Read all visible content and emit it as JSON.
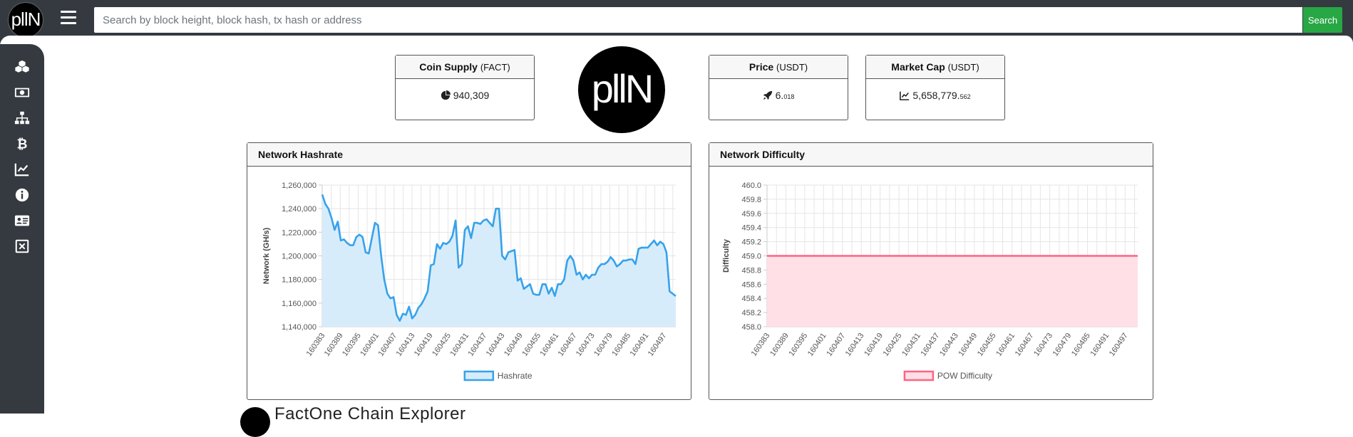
{
  "header": {
    "logo_text": "pllN",
    "search_placeholder": "Search by block height, block hash, tx hash or address",
    "search_button": "Search"
  },
  "sidebar": {
    "items": [
      {
        "icon": "cubes-icon"
      },
      {
        "icon": "money-bill-icon"
      },
      {
        "icon": "network-icon"
      },
      {
        "icon": "bitcoin-icon"
      },
      {
        "icon": "chart-line-icon"
      },
      {
        "icon": "info-circle-icon"
      },
      {
        "icon": "id-card-icon"
      },
      {
        "icon": "close-box-icon"
      }
    ]
  },
  "stats": {
    "coin_supply": {
      "label": "Coin Supply",
      "unit": "(FACT)",
      "value": "940,309"
    },
    "price": {
      "label": "Price",
      "unit": "(USDT)",
      "value_main": "6.",
      "value_small": "018"
    },
    "market_cap": {
      "label": "Market Cap",
      "unit": "(USDT)",
      "value_main": "5,658,779.",
      "value_small": "562"
    }
  },
  "center_logo_text": "pllN",
  "footer_text": "FactOne Chain Explorer",
  "colors": {
    "topbar": "#343a40",
    "search_button": "#28a745",
    "hashrate_line": "#36a2eb",
    "hashrate_fill": "#d7ecfb",
    "difficulty_line": "#ff6384",
    "difficulty_fill": "#ffe0e6"
  },
  "chart_data": [
    {
      "type": "area",
      "title": "Network Hashrate",
      "xlabel": "",
      "ylabel": "Network (GH/s)",
      "x_tick_labels": [
        "160383",
        "160389",
        "160395",
        "160401",
        "160407",
        "160413",
        "160419",
        "160425",
        "160431",
        "160437",
        "160443",
        "160449",
        "160455",
        "160461",
        "160467",
        "160473",
        "160479",
        "160485",
        "160491",
        "160497"
      ],
      "x_start": 160383,
      "x_end": 160501,
      "ylim": [
        1140000,
        1260000
      ],
      "y_tick_labels": [
        "1,260,000",
        "1,240,000",
        "1,220,000",
        "1,200,000",
        "1,180,000",
        "1,160,000",
        "1,140,000"
      ],
      "legend_position": "bottom",
      "series": [
        {
          "name": "Hashrate",
          "values": [
            1252000,
            1244000,
            1240000,
            1232000,
            1222000,
            1229000,
            1213000,
            1214000,
            1211000,
            1209000,
            1209000,
            1216000,
            1218000,
            1216000,
            1203000,
            1202000,
            1215000,
            1228000,
            1226000,
            1200000,
            1180000,
            1168000,
            1164000,
            1165000,
            1150000,
            1145000,
            1151000,
            1150000,
            1157000,
            1147000,
            1150000,
            1156000,
            1159000,
            1164000,
            1170000,
            1192000,
            1193000,
            1210000,
            1206000,
            1211000,
            1210000,
            1212000,
            1217000,
            1230000,
            1190000,
            1193000,
            1222000,
            1225000,
            1215000,
            1228000,
            1228000,
            1227000,
            1230000,
            1231000,
            1228000,
            1225000,
            1240000,
            1240000,
            1200000,
            1197000,
            1203000,
            1204000,
            1205000,
            1179000,
            1181000,
            1172000,
            1174000,
            1176000,
            1168000,
            1167000,
            1167000,
            1176000,
            1176000,
            1168000,
            1173000,
            1166000,
            1176000,
            1176000,
            1180000,
            1196000,
            1200000,
            1196000,
            1184000,
            1186000,
            1180000,
            1184000,
            1181000,
            1184000,
            1184000,
            1190000,
            1193000,
            1193000,
            1195000,
            1199000,
            1196000,
            1191000,
            1193000,
            1196000,
            1196000,
            1197000,
            1197000,
            1193000,
            1206000,
            1207000,
            1207000,
            1207000,
            1210000,
            1213000,
            1209000,
            1212000,
            1210000,
            1203000,
            1170000,
            1168000,
            1166000
          ]
        }
      ]
    },
    {
      "type": "area",
      "title": "Network Difficulty",
      "xlabel": "",
      "ylabel": "Difficulty",
      "x_tick_labels": [
        "160383",
        "160389",
        "160395",
        "160401",
        "160407",
        "160413",
        "160419",
        "160425",
        "160431",
        "160437",
        "160443",
        "160449",
        "160455",
        "160461",
        "160467",
        "160473",
        "160479",
        "160485",
        "160491",
        "160497"
      ],
      "x_start": 160383,
      "x_end": 160501,
      "ylim": [
        458.0,
        460.0
      ],
      "y_tick_labels": [
        "460.0",
        "459.8",
        "459.6",
        "459.4",
        "459.2",
        "459.0",
        "458.8",
        "458.6",
        "458.4",
        "458.2",
        "458.0"
      ],
      "legend_position": "bottom",
      "series": [
        {
          "name": "POW Difficulty",
          "values": [
            459.0,
            459.0
          ]
        }
      ]
    }
  ]
}
